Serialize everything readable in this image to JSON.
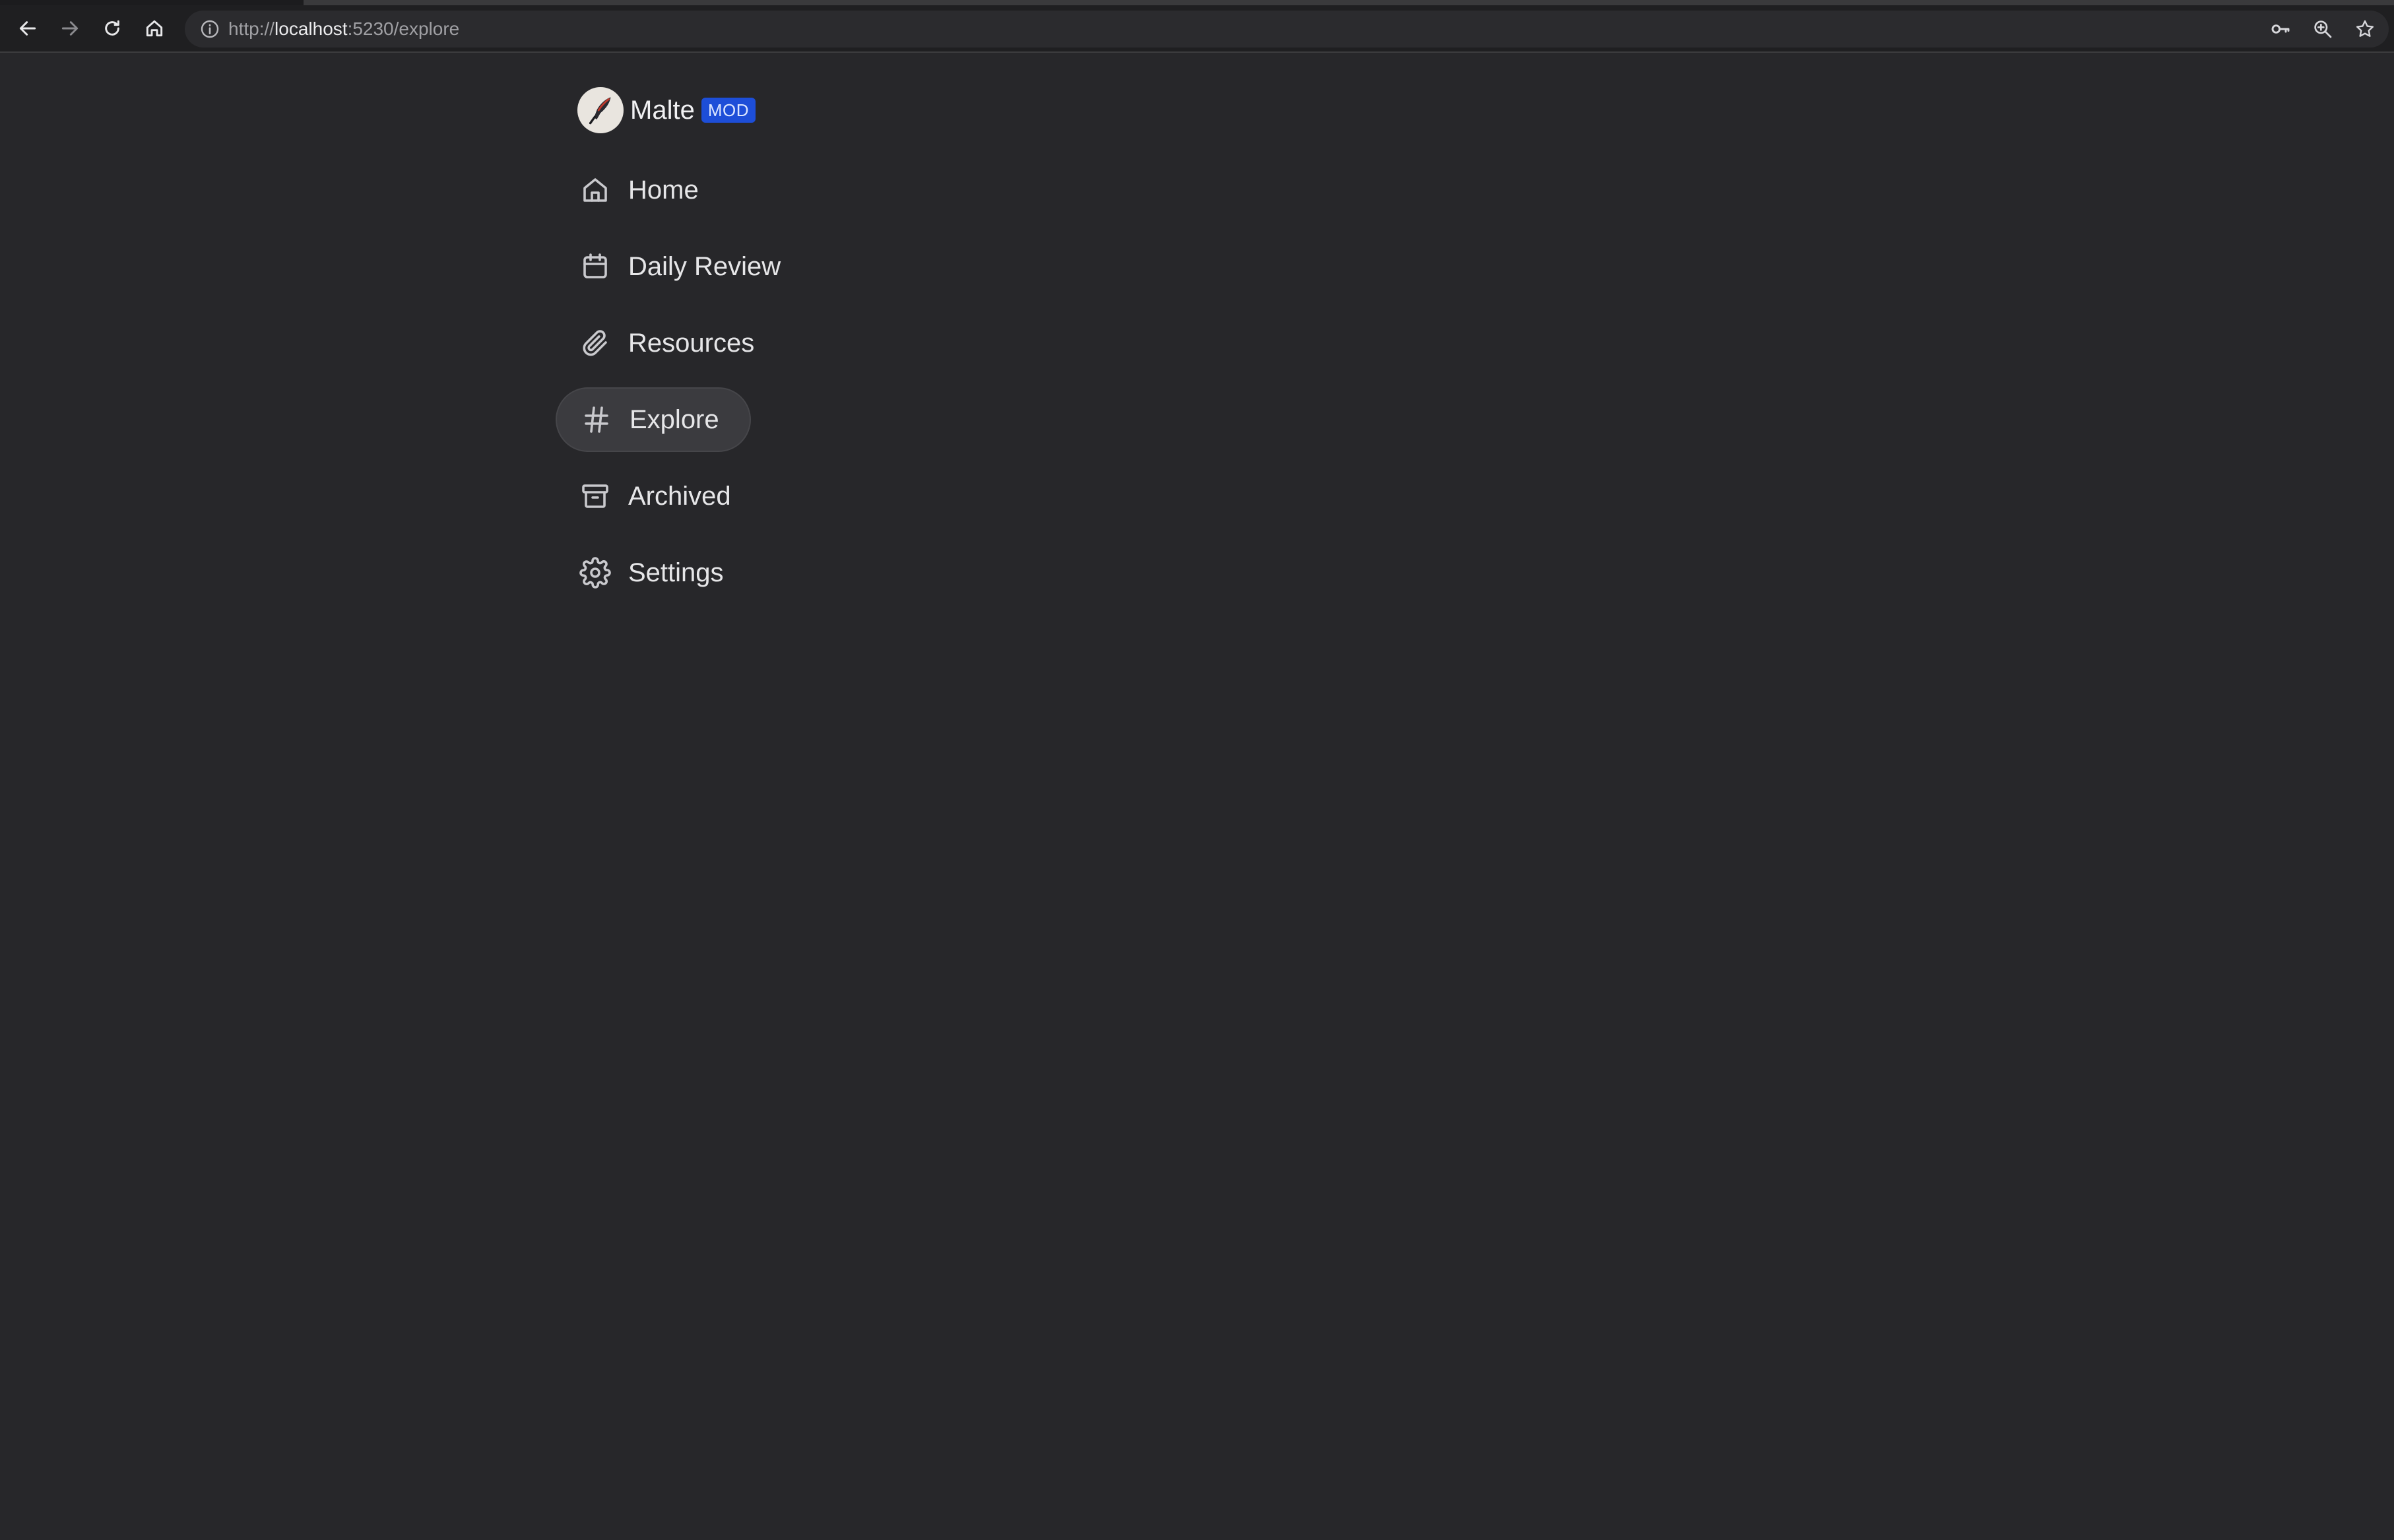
{
  "browser": {
    "url_scheme": "http://",
    "url_host": "localhost",
    "url_path": ":5230/explore",
    "nav": {
      "back_icon": "arrow-left-icon",
      "forward_icon": "arrow-right-icon",
      "reload_icon": "reload-icon",
      "home_icon": "home-icon"
    },
    "actions": [
      "key-icon",
      "zoom-icon",
      "star-icon"
    ]
  },
  "profile": {
    "name": "Malte",
    "role_badge": "MOD",
    "badge_color": "#1d4ed8"
  },
  "sidebar": {
    "items": [
      {
        "label": "Home",
        "icon": "home-icon",
        "active": false
      },
      {
        "label": "Daily Review",
        "icon": "calendar-icon",
        "active": false
      },
      {
        "label": "Resources",
        "icon": "paperclip-icon",
        "active": false
      },
      {
        "label": "Explore",
        "icon": "hash-icon",
        "active": true
      },
      {
        "label": "Archived",
        "icon": "archive-icon",
        "active": false
      },
      {
        "label": "Settings",
        "icon": "gear-icon",
        "active": false
      }
    ]
  },
  "theme": {
    "background": "#27272a",
    "active_item_bg": "#3b3b3f"
  }
}
